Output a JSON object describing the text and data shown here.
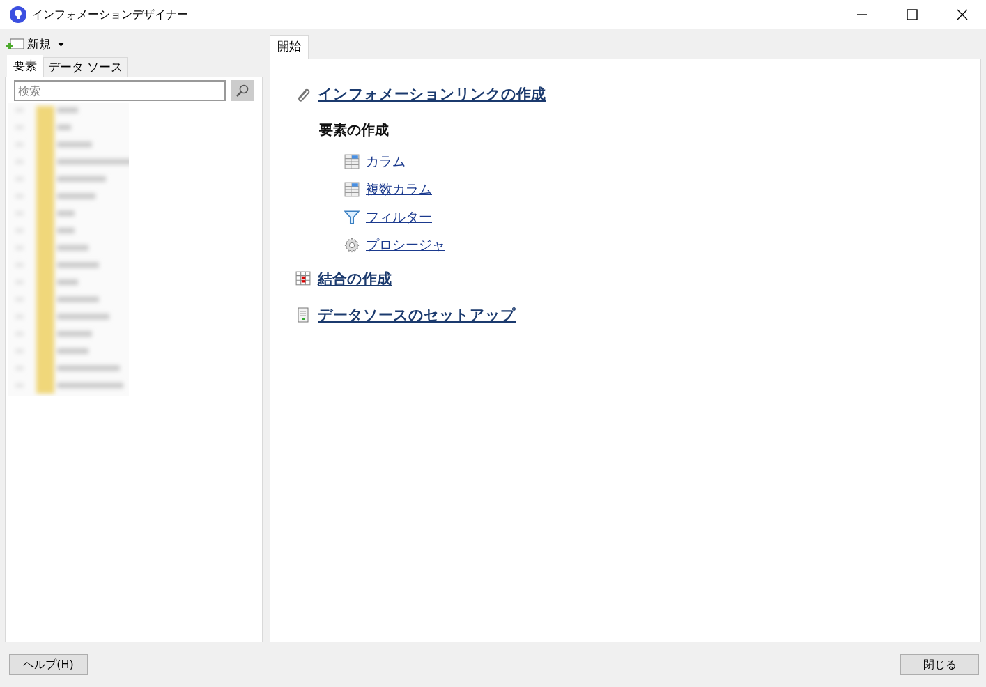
{
  "window": {
    "title": "インフォメーションデザイナー"
  },
  "toolbar": {
    "new_button": "新規"
  },
  "left_tabs": [
    {
      "label": "要素",
      "selected": true
    },
    {
      "label": "データ ソース",
      "selected": false
    }
  ],
  "search": {
    "placeholder": "検索"
  },
  "main_tabs": [
    {
      "label": "開始",
      "selected": true
    }
  ],
  "start_page": [
    {
      "kind": "link",
      "label": "インフォメーションリンクの作成"
    },
    {
      "kind": "heading",
      "label": "要素の作成",
      "children": [
        {
          "label": "カラム"
        },
        {
          "label": "複数カラム"
        },
        {
          "label": "フィルター"
        },
        {
          "label": "プロシージャ"
        }
      ]
    },
    {
      "kind": "link",
      "label": "結合の作成"
    },
    {
      "kind": "link",
      "label": "データソースのセットアップ"
    }
  ],
  "buttons": {
    "help": "ヘルプ(H)",
    "close": "閉じる"
  }
}
